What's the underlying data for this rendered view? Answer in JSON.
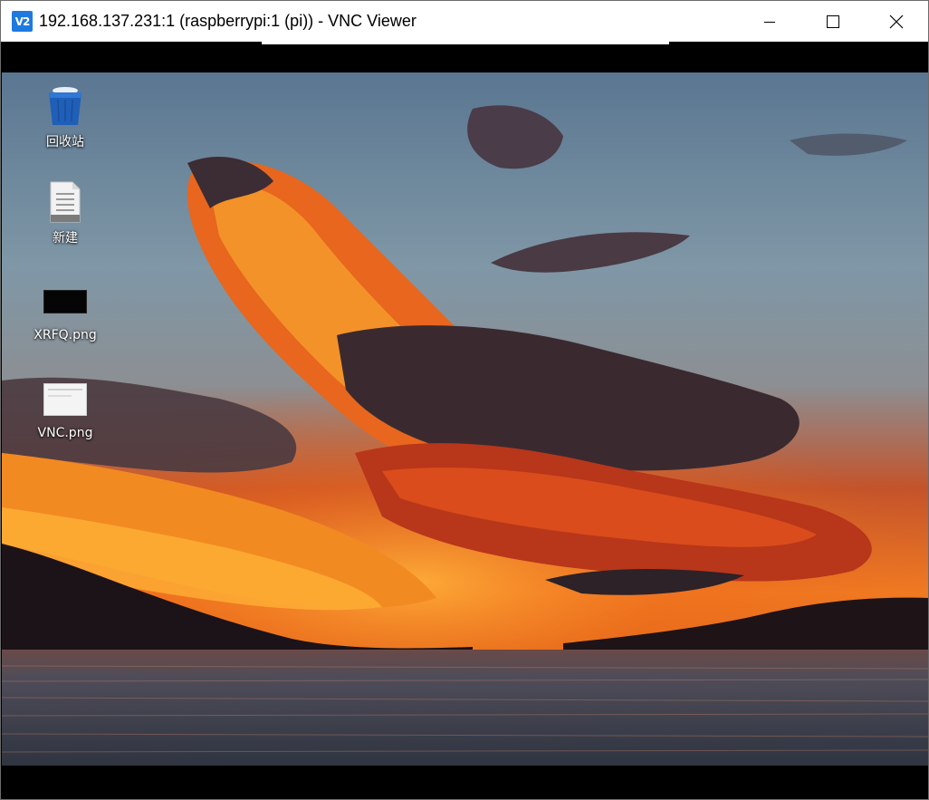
{
  "window": {
    "title": "192.168.137.231:1 (raspberrypi:1 (pi)) - VNC Viewer",
    "app_icon_text": "V2",
    "accent_color": "#1f7ae0"
  },
  "controls": {
    "minimize_icon": "minimize-icon",
    "maximize_icon": "maximize-icon",
    "close_icon": "close-icon"
  },
  "desktop": {
    "icons": [
      {
        "label": "回收站",
        "icon": "trash-icon"
      },
      {
        "label": "新建",
        "icon": "document-icon"
      },
      {
        "label": "XRFQ.png",
        "icon": "image-thumbnail-icon"
      },
      {
        "label": "VNC.png",
        "icon": "image-thumbnail-icon"
      }
    ],
    "wallpaper": "sunset-over-lake"
  }
}
